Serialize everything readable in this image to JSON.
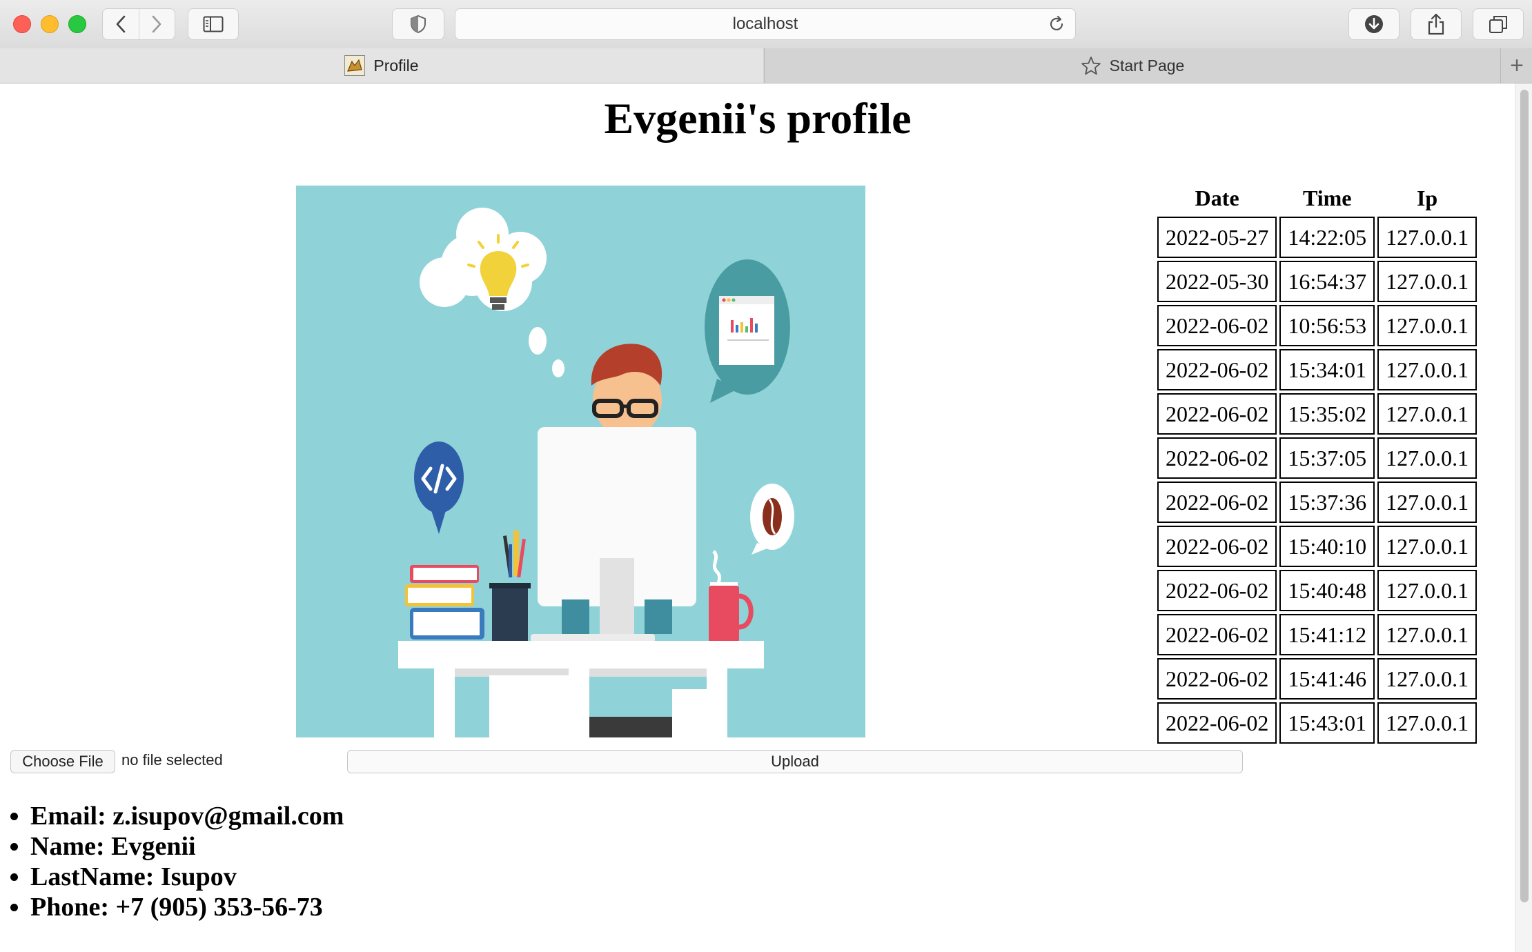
{
  "browser": {
    "address": "localhost",
    "tabs": [
      {
        "label": "Profile",
        "active": true
      },
      {
        "label": "Start Page",
        "active": false
      }
    ]
  },
  "page": {
    "title": "Evgenii's profile",
    "visits": {
      "headers": [
        "Date",
        "Time",
        "Ip"
      ],
      "rows": [
        [
          "2022-05-27",
          "14:22:05",
          "127.0.0.1"
        ],
        [
          "2022-05-30",
          "16:54:37",
          "127.0.0.1"
        ],
        [
          "2022-06-02",
          "10:56:53",
          "127.0.0.1"
        ],
        [
          "2022-06-02",
          "15:34:01",
          "127.0.0.1"
        ],
        [
          "2022-06-02",
          "15:35:02",
          "127.0.0.1"
        ],
        [
          "2022-06-02",
          "15:37:05",
          "127.0.0.1"
        ],
        [
          "2022-06-02",
          "15:37:36",
          "127.0.0.1"
        ],
        [
          "2022-06-02",
          "15:40:10",
          "127.0.0.1"
        ],
        [
          "2022-06-02",
          "15:40:48",
          "127.0.0.1"
        ],
        [
          "2022-06-02",
          "15:41:12",
          "127.0.0.1"
        ],
        [
          "2022-06-02",
          "15:41:46",
          "127.0.0.1"
        ],
        [
          "2022-06-02",
          "15:43:01",
          "127.0.0.1"
        ]
      ]
    },
    "upload": {
      "choose_label": "Choose File",
      "status": "no file selected",
      "upload_label": "Upload"
    },
    "info": [
      "Email: z.isupov@gmail.com",
      "Name: Evgenii",
      "LastName: Isupov",
      "Phone: +7 (905) 353-56-73"
    ]
  },
  "colors": {
    "illustration_bg": "#8fd3d8",
    "chrome_bg": "#dcdcdc"
  }
}
